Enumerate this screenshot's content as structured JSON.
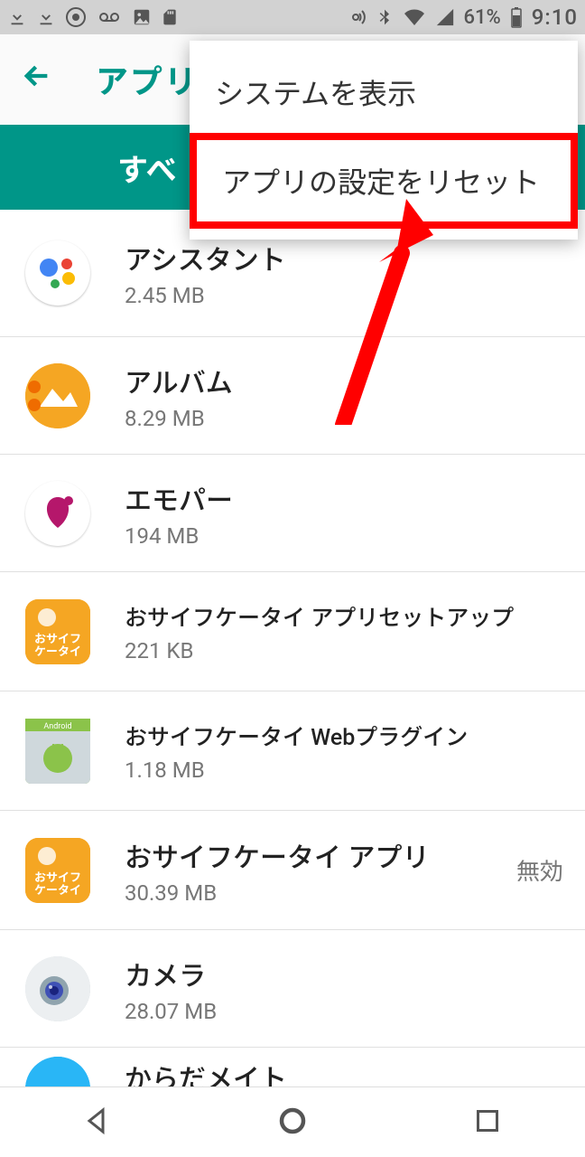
{
  "status_bar": {
    "battery_pct": "61%",
    "time": "9:10"
  },
  "app_bar": {
    "title": "アプリ"
  },
  "tab_strip": {
    "active_label": "すべ"
  },
  "popup_menu": {
    "items": [
      {
        "label": "システムを表示"
      },
      {
        "label": "アプリの設定をリセット"
      }
    ]
  },
  "apps": [
    {
      "name": "アシスタント",
      "size": "2.45 MB",
      "status": ""
    },
    {
      "name": "アルバム",
      "size": "8.29 MB",
      "status": ""
    },
    {
      "name": "エモパー",
      "size": "194 MB",
      "status": ""
    },
    {
      "name": "おサイフケータイ アプリセットアップ",
      "size": "221 KB",
      "status": ""
    },
    {
      "name": "おサイフケータイ Webプラグイン",
      "size": "1.18 MB",
      "status": ""
    },
    {
      "name": "おサイフケータイ アプリ",
      "size": "30.39 MB",
      "status": "無効"
    },
    {
      "name": "カメラ",
      "size": "28.07 MB",
      "status": ""
    },
    {
      "name": "からだメイト",
      "size": "",
      "status": ""
    }
  ]
}
